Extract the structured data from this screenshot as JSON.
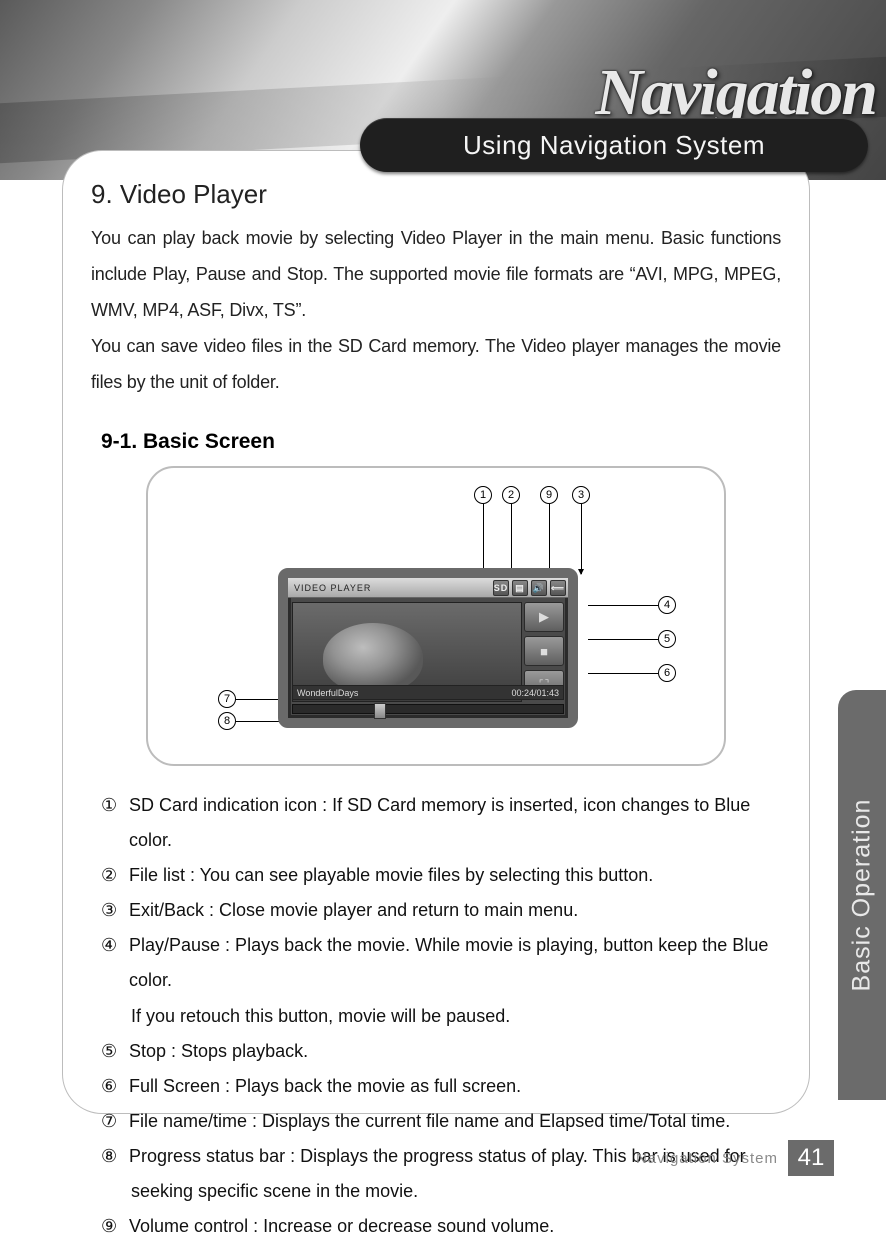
{
  "hero": {
    "brand": "Navigation"
  },
  "pill": {
    "label": "Using Navigation System"
  },
  "section": {
    "title": "9. Video Player",
    "intro1": "You can play back movie by selecting Video Player in the main menu. Basic functions include Play, Pause and Stop. The supported movie file formats are “AVI, MPG, MPEG, WMV, MP4, ASF, Divx, TS”.",
    "intro2": "You can save video files in the SD Card memory. The Video player manages the movie files by the unit of folder.",
    "subtitle": "9-1. Basic Screen"
  },
  "player": {
    "header_label": "VIDEO PLAYER",
    "filename": "WonderfulDays",
    "time": "00:24/01:43"
  },
  "callouts": {
    "c1": "1",
    "c2": "2",
    "c3": "3",
    "c4": "4",
    "c5": "5",
    "c6": "6",
    "c7": "7",
    "c8": "8",
    "c9": "9"
  },
  "items": [
    {
      "n": "①",
      "t": "SD Card indication icon : If SD Card memory is inserted, icon changes to Blue color."
    },
    {
      "n": "②",
      "t": "File list : You can see playable movie files by selecting this button."
    },
    {
      "n": "③",
      "t": "Exit/Back : Close movie player and return to main menu."
    },
    {
      "n": "④",
      "t": "Play/Pause : Plays back the movie. While movie is playing, button keep the Blue color."
    },
    {
      "n": "",
      "t": "If you retouch this button, movie will be paused.",
      "indent": true
    },
    {
      "n": "⑤",
      "t": "Stop : Stops playback."
    },
    {
      "n": "⑥",
      "t": "Full Screen : Plays back the movie as full screen."
    },
    {
      "n": "⑦",
      "t": "File name/time : Displays the current file name and Elapsed time/Total time."
    },
    {
      "n": "⑧",
      "t": "Progress status bar : Displays the progress status of play. This bar is used for"
    },
    {
      "n": "",
      "t": "seeking specific scene in the movie.",
      "indent": true
    },
    {
      "n": "⑨",
      "t": "Volume control : Increase or decrease sound volume."
    }
  ],
  "sidetab": {
    "label": "Basic Operation"
  },
  "footer": {
    "label": "Navigation System",
    "page": "41"
  }
}
